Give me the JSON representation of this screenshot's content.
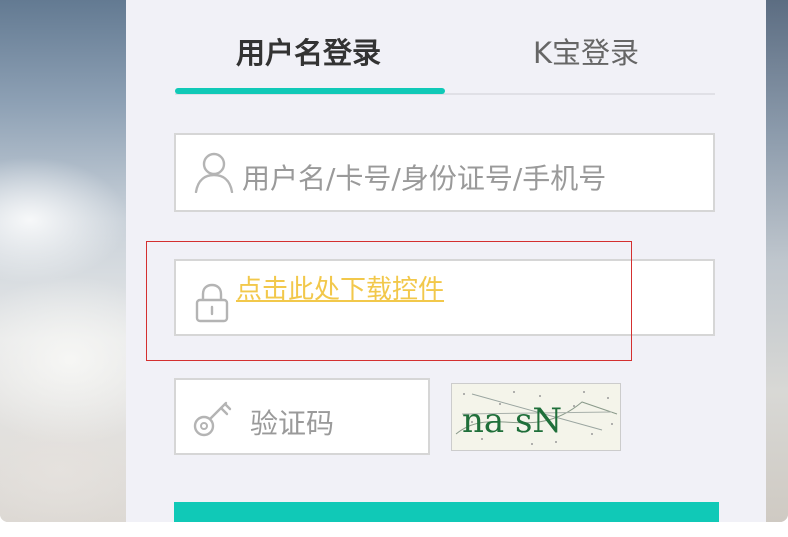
{
  "tabs": {
    "username_login": "用户名登录",
    "kbao_login": "K宝登录",
    "active": "username_login"
  },
  "username_field": {
    "placeholder": "用户名/卡号/身份证号/手机号",
    "icon": "user-icon"
  },
  "password_field": {
    "icon": "lock-icon",
    "download_link": "点击此处下载控件"
  },
  "captcha_field": {
    "placeholder": "验证码",
    "icon": "key-icon",
    "image_text": "na sN"
  },
  "colors": {
    "accent": "#10c9b7",
    "link": "#f2c84b",
    "highlight_box": "#d43030",
    "panel_bg": "#f1f1f7"
  }
}
